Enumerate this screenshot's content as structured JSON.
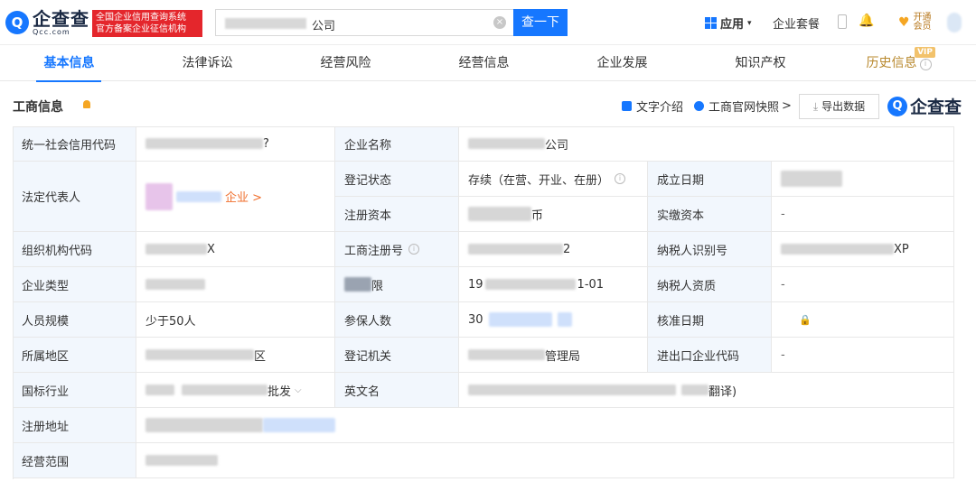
{
  "header": {
    "logo_mark": "Q",
    "logo_cn": "企查查",
    "logo_en": "Qcc.com",
    "gov_line1": "全国企业信用查询系统",
    "gov_line2": "官方备案企业征信机构",
    "search_value": "公司",
    "search_button": "查一下",
    "app_menu": "应用",
    "suite": "企业套餐",
    "vip_line1": "开通",
    "vip_line2": "会员"
  },
  "tabs": [
    {
      "label": "基本信息"
    },
    {
      "label": "法律诉讼"
    },
    {
      "label": "经营风险"
    },
    {
      "label": "经营信息"
    },
    {
      "label": "企业发展"
    },
    {
      "label": "知识产权"
    },
    {
      "label": "历史信息"
    }
  ],
  "vip_tag": "VIP",
  "section": {
    "title": "工商信息",
    "intro": "文字介绍",
    "snapshot": "工商官网快照",
    "snapshot_arrow": ">",
    "export": "导出数据",
    "brand": "企查查"
  },
  "table": {
    "labels": {
      "credit_code": "统一社会信用代码",
      "company_name": "企业名称",
      "legal_rep": "法定代表人",
      "reg_status": "登记状态",
      "established": "成立日期",
      "reg_capital": "注册资本",
      "paid_capital": "实缴资本",
      "org_code": "组织机构代码",
      "reg_number": "工商注册号",
      "tax_id": "纳税人识别号",
      "company_type": "企业类型",
      "term_suffix": "限",
      "taxpayer_qual": "纳税人资质",
      "staff_size": "人员规模",
      "insured": "参保人数",
      "approval_date": "核准日期",
      "region": "所属地区",
      "reg_authority": "登记机关",
      "ie_code": "进出口企业代码",
      "industry": "国标行业",
      "english_name": "英文名",
      "reg_address": "注册地址",
      "scope": "经营范围"
    },
    "values": {
      "credit_code_tail": "?",
      "company_name_tail": "公司",
      "legal_rep_link": "企业 >",
      "reg_status": "存续（在营、开业、在册）",
      "reg_capital_tail": "币",
      "paid_capital": "-",
      "org_code_tail": "X",
      "reg_number_tail": "2",
      "tax_id_tail": "XP",
      "term_head": "19",
      "term_tail": "1-01",
      "taxpayer_qual": "-",
      "staff_size": "少于50人",
      "insured_head": "30",
      "region_tail": "区",
      "reg_authority_tail": "管理局",
      "ie_code": "-",
      "industry_tail": "批发",
      "english_name_tail": "翻译)"
    }
  }
}
